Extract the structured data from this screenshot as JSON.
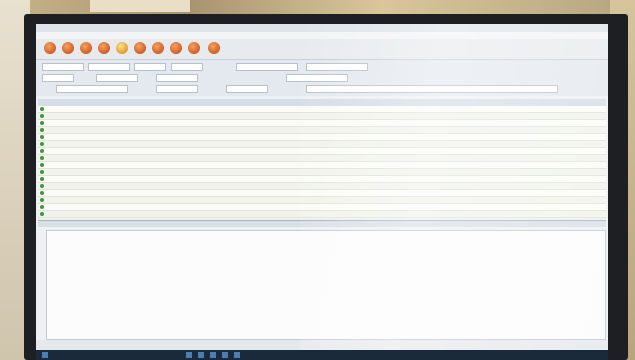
{
  "scene": {
    "description_colors": {
      "bezel": "#1d1f22",
      "screen": "#eef0f1",
      "accent_buttons": "#d97706",
      "row_icon": "#3f9a3f"
    }
  },
  "app": {
    "toolbar_buttons": [
      "btn-1",
      "btn-2",
      "btn-3",
      "btn-4",
      "btn-5",
      "btn-6",
      "btn-7",
      "btn-8",
      "btn-9",
      "btn-10"
    ],
    "active_toolbar_index": 4
  },
  "grid": {
    "row_count": 16
  }
}
